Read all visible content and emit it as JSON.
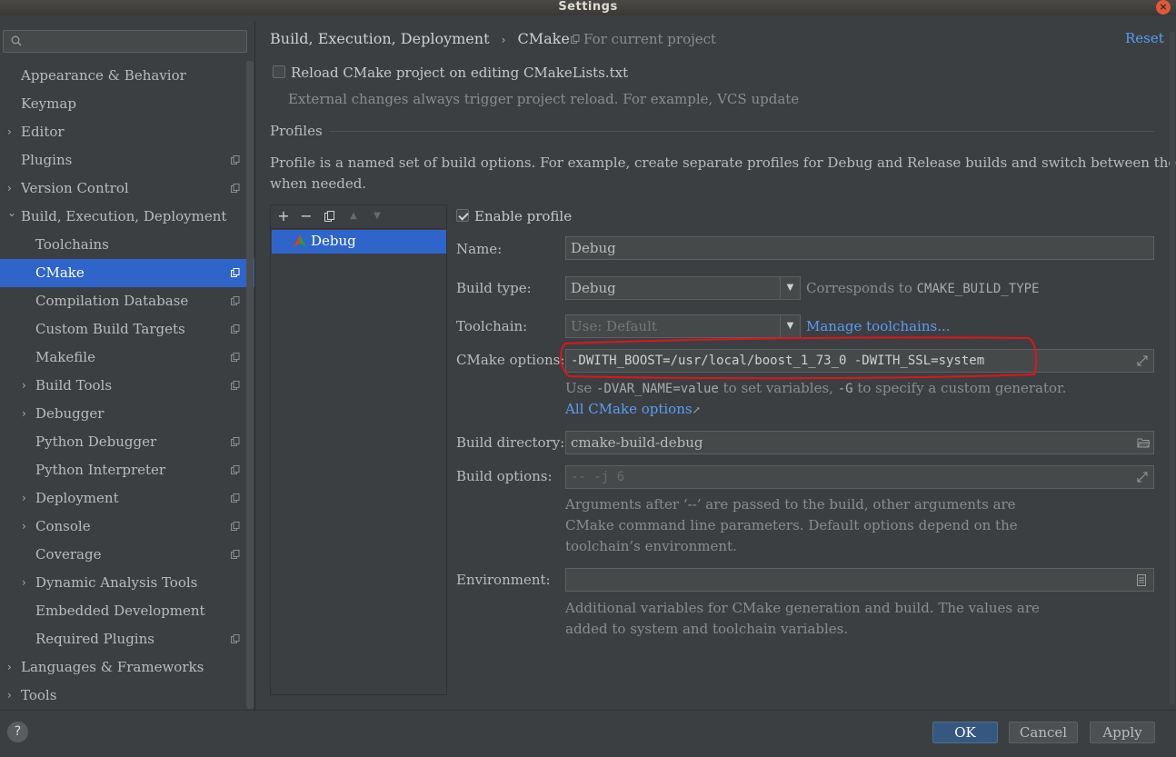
{
  "window": {
    "title": "Settings",
    "close_glyph": "×"
  },
  "sidebar": {
    "search_placeholder": "",
    "items": [
      {
        "label": "Appearance & Behavior",
        "expandable": false,
        "level": 0,
        "project": false
      },
      {
        "label": "Keymap",
        "expandable": false,
        "level": 0,
        "project": false
      },
      {
        "label": "Editor",
        "expandable": true,
        "level": 0,
        "project": false
      },
      {
        "label": "Plugins",
        "expandable": false,
        "level": 0,
        "project": true
      },
      {
        "label": "Version Control",
        "expandable": true,
        "level": 0,
        "project": true
      },
      {
        "label": "Build, Execution, Deployment",
        "expandable": true,
        "expanded": true,
        "level": 0,
        "project": false
      },
      {
        "label": "Toolchains",
        "expandable": false,
        "level": 1,
        "project": false
      },
      {
        "label": "CMake",
        "expandable": false,
        "level": 1,
        "project": true,
        "selected": true
      },
      {
        "label": "Compilation Database",
        "expandable": false,
        "level": 1,
        "project": true
      },
      {
        "label": "Custom Build Targets",
        "expandable": false,
        "level": 1,
        "project": true
      },
      {
        "label": "Makefile",
        "expandable": false,
        "level": 1,
        "project": true
      },
      {
        "label": "Build Tools",
        "expandable": true,
        "level": 1,
        "project": true
      },
      {
        "label": "Debugger",
        "expandable": true,
        "level": 1,
        "project": false
      },
      {
        "label": "Python Debugger",
        "expandable": false,
        "level": 1,
        "project": true
      },
      {
        "label": "Python Interpreter",
        "expandable": false,
        "level": 1,
        "project": true
      },
      {
        "label": "Deployment",
        "expandable": true,
        "level": 1,
        "project": true
      },
      {
        "label": "Console",
        "expandable": true,
        "level": 1,
        "project": true
      },
      {
        "label": "Coverage",
        "expandable": false,
        "level": 1,
        "project": true
      },
      {
        "label": "Dynamic Analysis Tools",
        "expandable": true,
        "level": 1,
        "project": false
      },
      {
        "label": "Embedded Development",
        "expandable": false,
        "level": 1,
        "project": false
      },
      {
        "label": "Required Plugins",
        "expandable": false,
        "level": 1,
        "project": true
      },
      {
        "label": "Languages & Frameworks",
        "expandable": true,
        "level": 0,
        "project": false
      },
      {
        "label": "Tools",
        "expandable": true,
        "level": 0,
        "project": false
      }
    ]
  },
  "header": {
    "breadcrumb": [
      "Build, Execution, Deployment",
      "CMake"
    ],
    "breadcrumb_sep": "›",
    "for_current_project": "For current project",
    "reset": "Reset"
  },
  "reload": {
    "label": "Reload CMake project on editing CMakeLists.txt",
    "checked": false,
    "hint": "External changes always trigger project reload. For example, VCS update"
  },
  "profiles": {
    "section_title": "Profiles",
    "description_line1": "Profile is a named set of build options. For example, create separate profiles for Debug and Release builds and switch between them",
    "description_line2": "when needed.",
    "toolbar": {
      "add": "+",
      "remove": "−",
      "up": "▲",
      "down": "▼"
    },
    "list": [
      "Debug"
    ]
  },
  "form": {
    "enable_profile_label": "Enable profile",
    "enable_profile_checked": true,
    "name_label": "Name:",
    "name_value": "Debug",
    "build_type_label": "Build type:",
    "build_type_value": "Debug",
    "build_type_note_prefix": "Corresponds to",
    "build_type_note_code": "CMAKE_BUILD_TYPE",
    "toolchain_label": "Toolchain:",
    "toolchain_value": "Use: Default",
    "manage_toolchains": "Manage toolchains...",
    "cmake_options_label": "CMake options:",
    "cmake_options_value": "-DWITH_BOOST=/usr/local/boost_1_73_0 -DWITH_SSL=system",
    "cmake_hint_use": "Use",
    "cmake_hint_code1": "-DVAR_NAME=value",
    "cmake_hint_mid": "to set variables,",
    "cmake_hint_code2": "-G",
    "cmake_hint_end": "to specify a custom generator.",
    "all_cmake_options": "All CMake options",
    "all_cmake_options_arrow": "↗",
    "build_dir_label": "Build directory:",
    "build_dir_value": "cmake-build-debug",
    "build_options_label": "Build options:",
    "build_options_placeholder": "-- -j 6",
    "build_options_hint1": "Arguments after ‘--’ are passed to the build, other arguments are",
    "build_options_hint2": "CMake command line parameters. Default options depend on the",
    "build_options_hint3": "toolchain’s environment.",
    "environment_label": "Environment:",
    "environment_value": "",
    "environment_hint1": "Additional variables for CMake generation and build. The values are",
    "environment_hint2": "added to system and toolchain variables."
  },
  "footer": {
    "help": "?",
    "ok": "OK",
    "cancel": "Cancel",
    "apply": "Apply"
  },
  "colors": {
    "accent": "#2f65ca",
    "link": "#589df6",
    "annotation": "#e0141e"
  }
}
